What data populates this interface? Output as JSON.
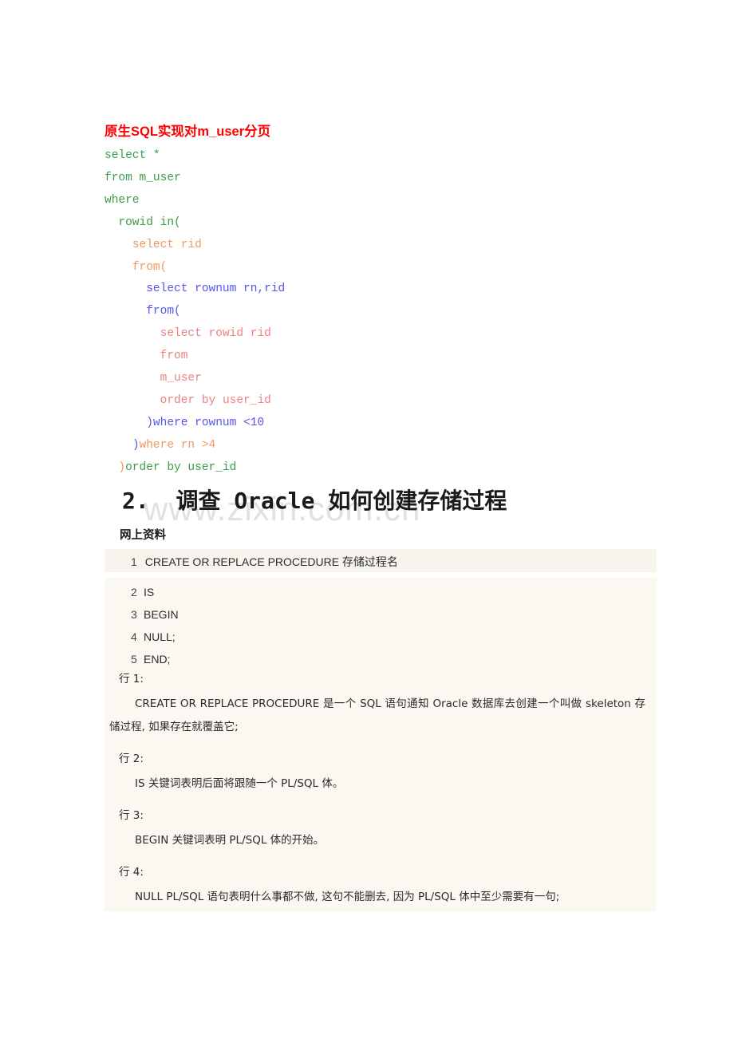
{
  "document": {
    "watermark": "www.zixin.com.cn",
    "colors": {
      "title_red": "#ff0000",
      "sql_level_0": "#3b9c48",
      "sql_level_1": "#f2995e",
      "sql_level_2": "#5555ee",
      "sql_level_3": "#f08080",
      "panel_bg": "#faf8f1",
      "panel_header_bg": "#f6f4ec",
      "watermark_gray": "#e3e1de"
    }
  },
  "sql_section": {
    "title": "原生SQL实现对m_user分页",
    "lines": [
      {
        "indent": 0,
        "parts": [
          {
            "text": "select *",
            "color": "green"
          }
        ]
      },
      {
        "indent": 0,
        "parts": [
          {
            "text": "from m_user",
            "color": "green"
          }
        ]
      },
      {
        "indent": 0,
        "parts": [
          {
            "text": "where",
            "color": "green"
          }
        ]
      },
      {
        "indent": 1,
        "parts": [
          {
            "text": "rowid in(",
            "color": "green"
          }
        ]
      },
      {
        "indent": 2,
        "parts": [
          {
            "text": "select rid",
            "color": "orange"
          }
        ]
      },
      {
        "indent": 2,
        "parts": [
          {
            "text": "from(",
            "color": "orange"
          }
        ]
      },
      {
        "indent": 3,
        "parts": [
          {
            "text": "select rownum rn,rid",
            "color": "blue"
          }
        ]
      },
      {
        "indent": 3,
        "parts": [
          {
            "text": "from(",
            "color": "blue"
          }
        ]
      },
      {
        "indent": 4,
        "parts": [
          {
            "text": "select rowid rid",
            "color": "pink"
          }
        ]
      },
      {
        "indent": 4,
        "parts": [
          {
            "text": "from",
            "color": "pink"
          }
        ]
      },
      {
        "indent": 4,
        "parts": [
          {
            "text": "m_user",
            "color": "pink"
          }
        ]
      },
      {
        "indent": 4,
        "parts": [
          {
            "text": "order by user_id",
            "color": "pink"
          }
        ]
      },
      {
        "indent": 3,
        "parts": [
          {
            "text": ")",
            "color": "blue"
          },
          {
            "text": "where rownum <10",
            "color": "blue"
          }
        ]
      },
      {
        "indent": 2,
        "parts": [
          {
            "text": ")",
            "color": "blue"
          },
          {
            "text": "where rn >4",
            "color": "orange"
          }
        ]
      },
      {
        "indent": 1,
        "parts": [
          {
            "text": ")",
            "color": "orange"
          },
          {
            "text": "order by user_id",
            "color": "green"
          }
        ]
      }
    ]
  },
  "section2": {
    "number": "2.",
    "heading_cjk_1": "调查",
    "heading_latin": "Oracle",
    "heading_cjk_2": "如何创建存储过程",
    "subheading": "网上资料",
    "code": {
      "first_line": {
        "no": "1",
        "text": "CREATE OR REPLACE PROCEDURE 存储过程名"
      },
      "rest_lines": [
        {
          "no": "2",
          "text": "IS"
        },
        {
          "no": "3",
          "text": "BEGIN"
        },
        {
          "no": "4",
          "text": "NULL;"
        },
        {
          "no": "5",
          "text": "END;"
        }
      ]
    },
    "explanations": [
      {
        "label": "行 1:",
        "body": "CREATE OR REPLACE PROCEDURE 是一个 SQL 语句通知 Oracle 数据库去创建一个叫做 skeleton 存储过程, 如果存在就覆盖它;"
      },
      {
        "label": "行 2:",
        "body": "IS 关键词表明后面将跟随一个 PL/SQL 体。"
      },
      {
        "label": "行 3:",
        "body": "BEGIN 关键词表明 PL/SQL 体的开始。"
      },
      {
        "label": "行 4:",
        "body": "NULL PL/SQL 语句表明什么事都不做, 这句不能删去, 因为 PL/SQL 体中至少需要有一句;"
      }
    ]
  }
}
